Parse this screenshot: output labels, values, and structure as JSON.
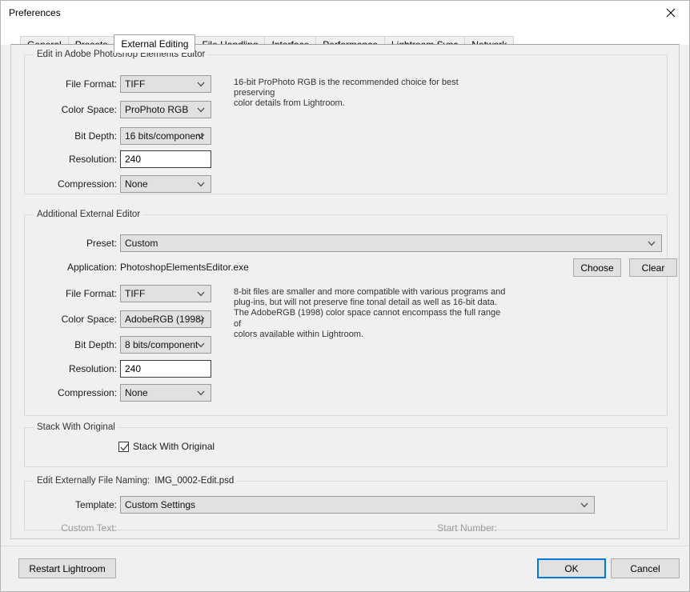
{
  "window": {
    "title": "Preferences",
    "close_icon": "close-icon"
  },
  "tabs": [
    {
      "label": "General",
      "active": false
    },
    {
      "label": "Presets",
      "active": false
    },
    {
      "label": "External Editing",
      "active": true
    },
    {
      "label": "File Handling",
      "active": false
    },
    {
      "label": "Interface",
      "active": false
    },
    {
      "label": "Performance",
      "active": false
    },
    {
      "label": "Lightroom Sync",
      "active": false
    },
    {
      "label": "Network",
      "active": false
    }
  ],
  "primary_editor": {
    "group_title": "Edit in Adobe Photoshop Elements Editor",
    "file_format_label": "File Format:",
    "file_format_value": "TIFF",
    "color_space_label": "Color Space:",
    "color_space_value": "ProPhoto RGB",
    "bit_depth_label": "Bit Depth:",
    "bit_depth_value": "16 bits/component",
    "resolution_label": "Resolution:",
    "resolution_value": "240",
    "compression_label": "Compression:",
    "compression_value": "None",
    "help_line1": "16-bit ProPhoto RGB is the recommended choice for best preserving",
    "help_line2": "color details from Lightroom."
  },
  "additional_editor": {
    "group_title": "Additional External Editor",
    "preset_label": "Preset:",
    "preset_value": "Custom",
    "application_label": "Application:",
    "application_value": "PhotoshopElementsEditor.exe",
    "choose_label": "Choose",
    "clear_label": "Clear",
    "file_format_label": "File Format:",
    "file_format_value": "TIFF",
    "color_space_label": "Color Space:",
    "color_space_value": "AdobeRGB (1998)",
    "bit_depth_label": "Bit Depth:",
    "bit_depth_value": "8 bits/component",
    "resolution_label": "Resolution:",
    "resolution_value": "240",
    "compression_label": "Compression:",
    "compression_value": "None",
    "help_line1": "8-bit files are smaller and more compatible with various programs and",
    "help_line2": "plug-ins, but will not preserve fine tonal detail as well as 16-bit data.",
    "help_line3": "The AdobeRGB (1998) color space cannot encompass the full range of",
    "help_line4": "colors available within Lightroom."
  },
  "stack": {
    "group_title": "Stack With Original",
    "checkbox_label": "Stack With Original",
    "checked": true
  },
  "file_naming": {
    "group_title": "Edit Externally File Naming:",
    "sample_filename": "IMG_0002-Edit.psd",
    "template_label": "Template:",
    "template_value": "Custom Settings",
    "custom_text_label": "Custom Text:",
    "custom_text_value": "",
    "start_number_label": "Start Number:",
    "start_number_value": ""
  },
  "footer": {
    "restart_label": "Restart Lightroom",
    "ok_label": "OK",
    "cancel_label": "Cancel"
  },
  "colors": {
    "accent": "#0078d7",
    "dialog_bg": "#f0f0f0",
    "control_bg": "#e1e1e1",
    "input_bg": "#ffffff"
  }
}
